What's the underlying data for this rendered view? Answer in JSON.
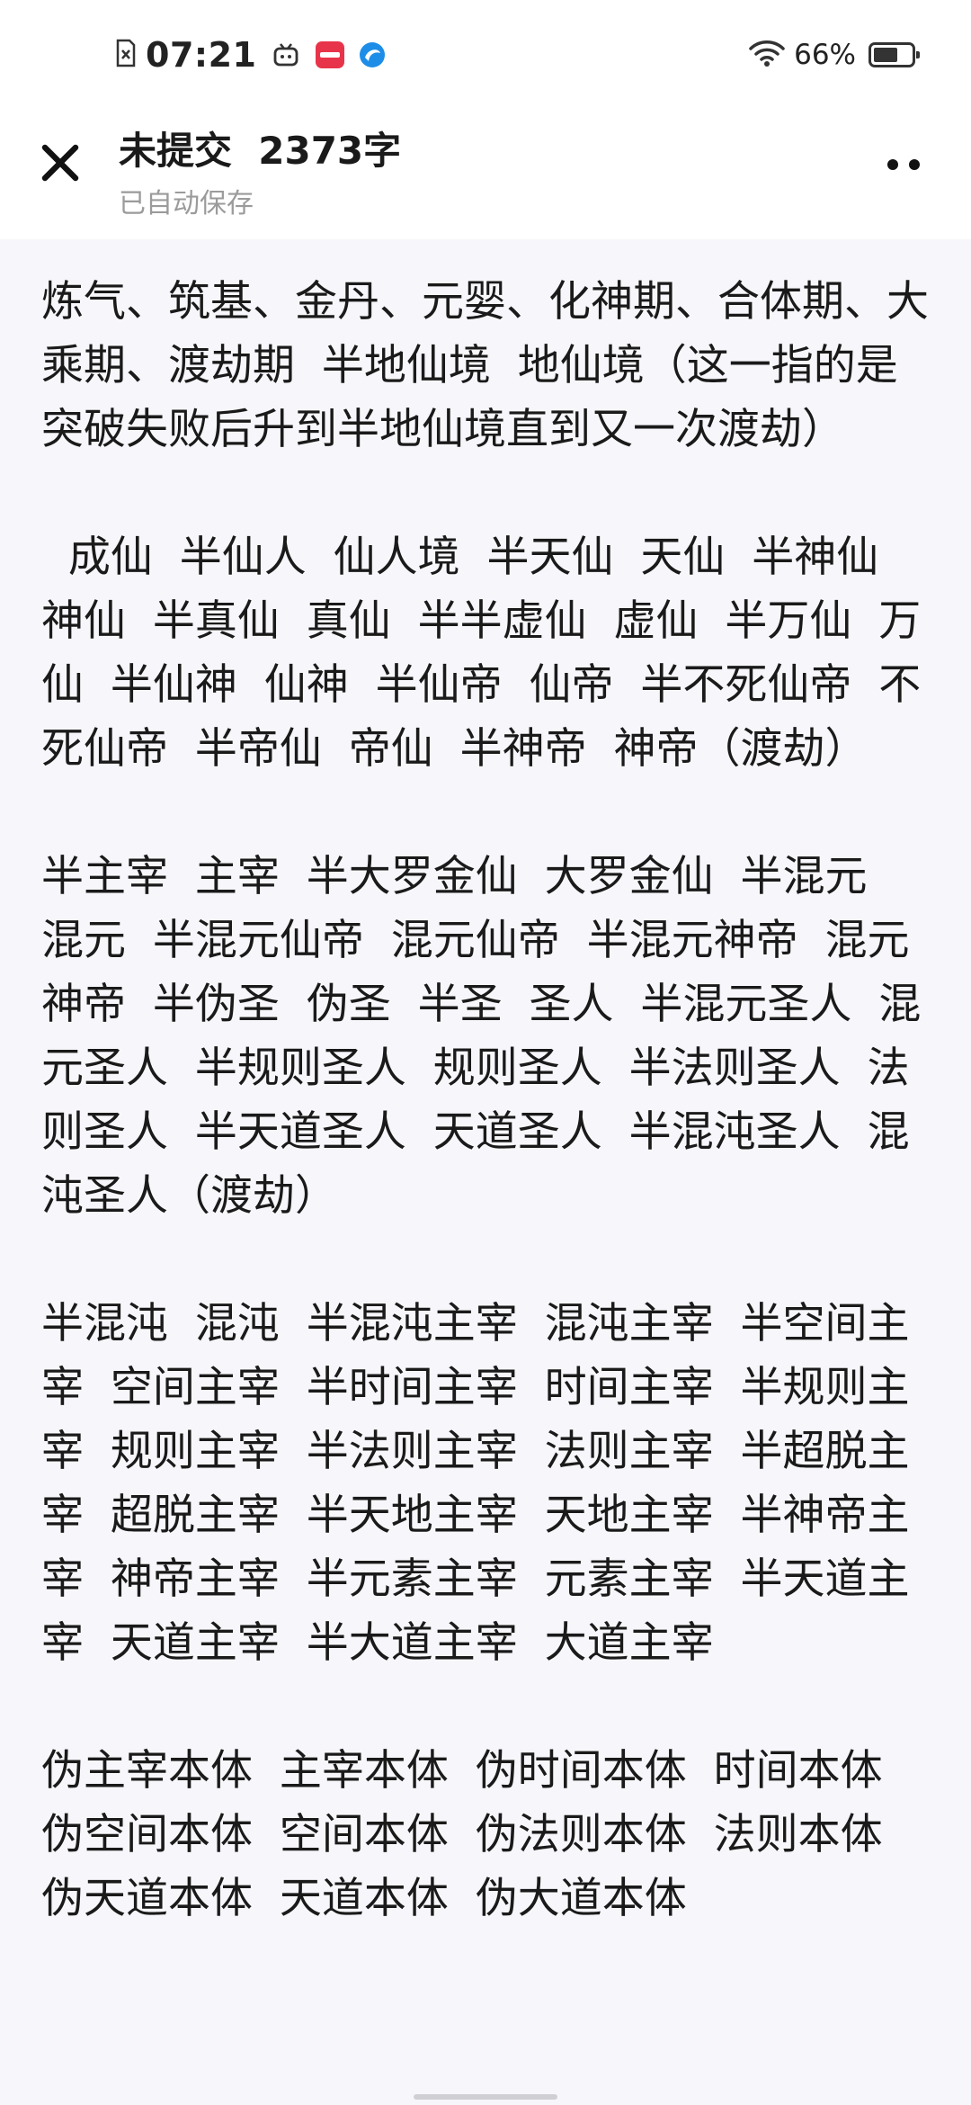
{
  "status_bar": {
    "time": "07:21",
    "battery_percent": "66%",
    "battery_level": 0.66,
    "icons": [
      "sim-icon",
      "tv-icon",
      "app-red-icon",
      "app-blue-icon",
      "wifi-icon",
      "battery-icon"
    ],
    "accent_colors": {
      "app_red": "#e8344a",
      "app_blue": "#1e8de8"
    }
  },
  "header": {
    "title": "未提交  2373字",
    "subtitle": "已自动保存",
    "close_icon": "close-icon",
    "more_icon": "more-icon"
  },
  "editor": {
    "paragraphs": [
      "炼气、筑基、金丹、元婴、化神期、合体期、大乘期、渡劫期  半地仙境  地仙境（这一指的是突破失败后升到半地仙境直到又一次渡劫）",
      "  成仙  半仙人  仙人境  半天仙  天仙  半神仙  神仙  半真仙  真仙  半半虚仙  虚仙  半万仙  万仙  半仙神  仙神  半仙帝  仙帝  半不死仙帝  不死仙帝  半帝仙  帝仙  半神帝  神帝（渡劫）",
      "半主宰  主宰  半大罗金仙  大罗金仙  半混元  混元  半混元仙帝  混元仙帝  半混元神帝  混元神帝  半伪圣  伪圣  半圣  圣人  半混元圣人  混元圣人  半规则圣人  规则圣人  半法则圣人  法则圣人  半天道圣人  天道圣人  半混沌圣人  混沌圣人（渡劫）",
      "半混沌  混沌  半混沌主宰  混沌主宰  半空间主宰  空间主宰  半时间主宰  时间主宰  半规则主宰  规则主宰  半法则主宰  法则主宰  半超脱主宰  超脱主宰  半天地主宰  天地主宰  半神帝主宰  神帝主宰  半元素主宰  元素主宰  半天道主宰  天道主宰  半大道主宰  大道主宰",
      "伪主宰本体  主宰本体  伪时间本体  时间本体  伪空间本体  空间本体  伪法则本体  法则本体  伪天道本体  天道本体  伪大道本体"
    ]
  }
}
